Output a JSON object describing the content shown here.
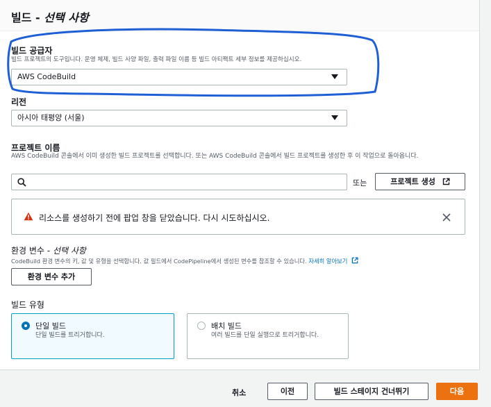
{
  "section": {
    "title": "빌드",
    "title_sep": " - ",
    "title_optional": "선택 사항"
  },
  "provider": {
    "label": "빌드 공급자",
    "description": "빌드 프로젝트의 도구입니다. 운영 체제, 빌드 사양 파일, 출력 파일 이름 등 빌드 아티팩트 세부 정보를 제공하십시오.",
    "selected": "AWS CodeBuild"
  },
  "region": {
    "label": "리전",
    "selected": "아시아 태평양 (서울)"
  },
  "project": {
    "label": "프로젝트 이름",
    "description": "AWS CodeBuild 콘솔에서 이미 생성한 빌드 프로젝트를 선택합니다. 또는 AWS CodeBuild 콘솔에서 빌드 프로젝트를 생성한 후 이 작업으로 돌아옵니다.",
    "search_value": "",
    "or_text": "또는",
    "create_button": "프로젝트 생성"
  },
  "alert": {
    "message": "리소스를 생성하기 전에 팝업 창을 닫았습니다. 다시 시도하십시오."
  },
  "env": {
    "label": "환경 변수",
    "label_sep": " - ",
    "label_optional": "선택 사항",
    "description": "CodeBuild 환경 변수의 키, 값 및 유형을 선택합니다. 값 필드에서 CodePipeline에서 생성된 변수를 참조할 수 있습니다.",
    "learn_more": "자세히 알아보기",
    "add_button": "환경 변수 추가"
  },
  "build_type": {
    "label": "빌드 유형",
    "options": [
      {
        "title": "단일 빌드",
        "desc": "단일 빌드를 트리거합니다.",
        "selected": true
      },
      {
        "title": "배치 빌드",
        "desc": "여러 빌드를 단일 실행으로 트리거합니다.",
        "selected": false
      }
    ]
  },
  "footer": {
    "cancel": "취소",
    "previous": "이전",
    "skip": "빌드 스테이지 건너뛰기",
    "next": "다음"
  },
  "colors": {
    "primary": "#ec7211",
    "link": "#0073bb",
    "alert_icon": "#d13212",
    "annotation": "#1f5fd6"
  }
}
